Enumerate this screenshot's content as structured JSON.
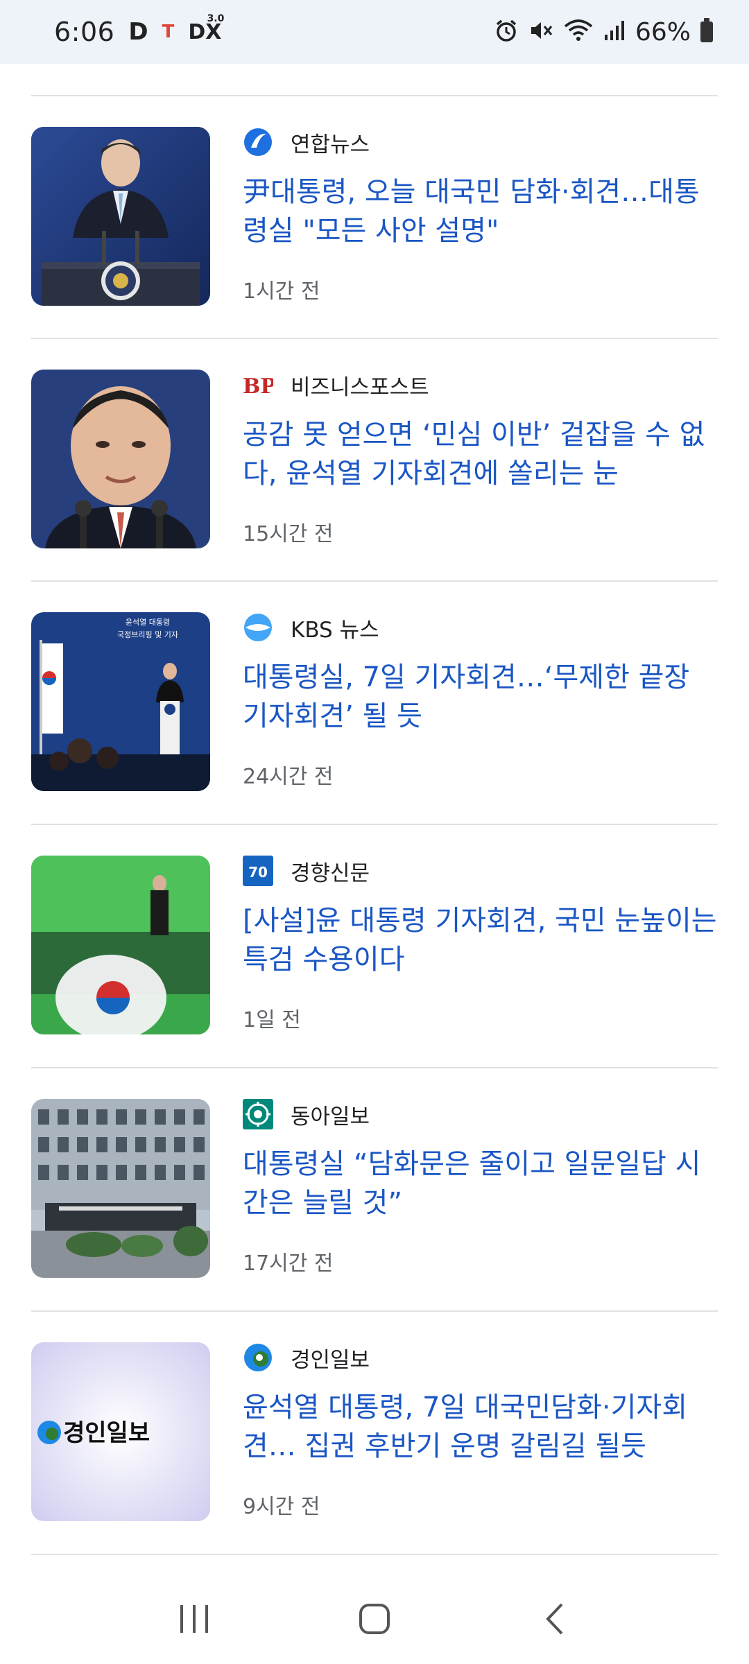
{
  "status_bar": {
    "time": "6:06",
    "app_d": "D",
    "app_t": "T",
    "app_dx": "DX",
    "app_dx_sup": "3.0",
    "battery": "66%"
  },
  "articles": [
    {
      "source": "연합뉴스",
      "headline": "尹대통령, 오늘 대국민 담화·회견…대통령실 \"모든 사안 설명\"",
      "time": "1시간 전",
      "logo_icon": "yonhap-logo-icon",
      "thumb_icon": "president-podium-photo"
    },
    {
      "source": "비즈니스포스트",
      "logo_text": "BP",
      "headline": "공감 못 얻으면 ‘민심 이반’ 겉잡을 수 없다, 윤석열 기자회견에 쏠리는 눈",
      "time": "15시간 전",
      "logo_icon": "businesspost-logo-icon",
      "thumb_icon": "president-closeup-photo"
    },
    {
      "source": "KBS 뉴스",
      "thumb_text_1": "윤석열 대통령",
      "thumb_text_2": "국정브리핑 및 기자",
      "headline": "대통령실, 7일 기자회견…‘무제한 끝장 기자회견’ 될 듯",
      "time": "24시간 전",
      "logo_icon": "kbs-logo-icon",
      "thumb_icon": "press-briefing-photo"
    },
    {
      "source": "경향신문",
      "logo_text": "70",
      "headline": "[사설]윤 대통령 기자회견, 국민 눈높이는 특검 수용이다",
      "time": "1일 전",
      "logo_icon": "kyunghyang-logo-icon",
      "thumb_icon": "flag-stage-photo"
    },
    {
      "source": "동아일보",
      "headline": "대통령실 “담화문은 줄이고 일문일답 시간은 늘릴 것”",
      "time": "17시간 전",
      "logo_icon": "donga-logo-icon",
      "thumb_icon": "presidential-office-building-photo"
    },
    {
      "source": "경인일보",
      "headline": "윤석열 대통령, 7일 대국민담화·기자회견… 집권 후반기 운명 갈림길 될듯",
      "time": "9시간 전",
      "logo_icon": "kyeongin-logo-icon",
      "thumb_icon": "kyeongin-ilbo-logo-image",
      "thumb_text": "경인일보"
    }
  ],
  "nav": {
    "recents_icon": "recents-icon",
    "home_icon": "home-icon",
    "back_icon": "back-icon"
  },
  "colors": {
    "headline": "#1a56c4",
    "status_bar_bg": "#eef2f9",
    "divider": "#e2e2e2",
    "time_text": "#5f6368"
  }
}
